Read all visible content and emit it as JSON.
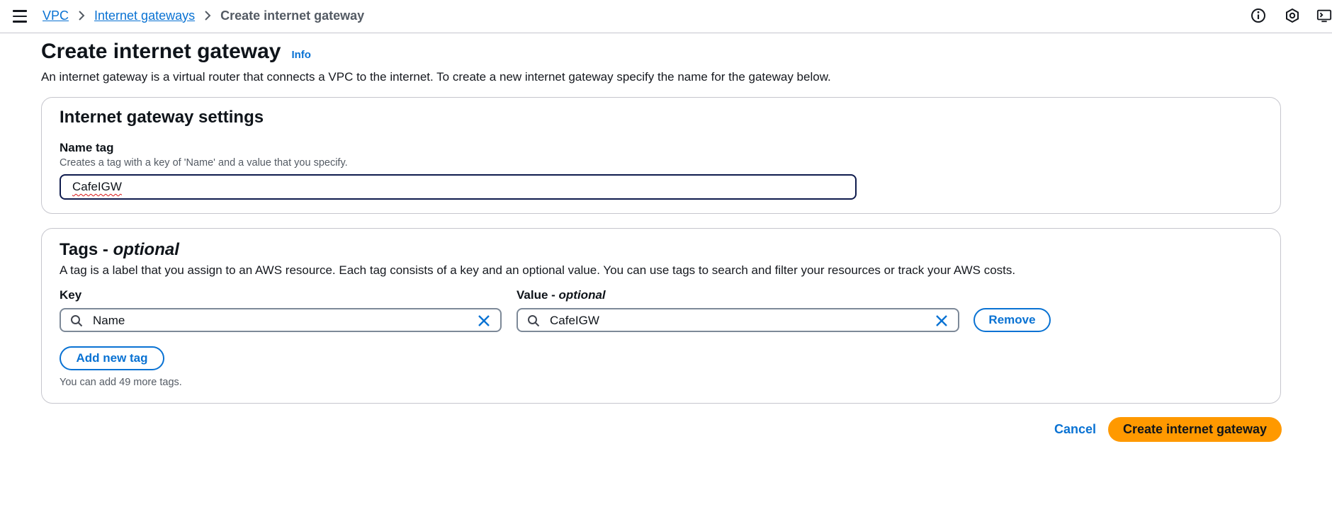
{
  "breadcrumb": {
    "items": [
      {
        "label": "VPC"
      },
      {
        "label": "Internet gateways"
      },
      {
        "label": "Create internet gateway"
      }
    ]
  },
  "header_icons": [
    "info-circle-icon",
    "settings-hex-icon",
    "cloudshell-icon"
  ],
  "page": {
    "title": "Create internet gateway",
    "info_label": "Info",
    "description": "An internet gateway is a virtual router that connects a VPC to the internet. To create a new internet gateway specify the name for the gateway below."
  },
  "settings": {
    "title": "Internet gateway settings",
    "name_tag_label": "Name tag",
    "name_tag_hint": "Creates a tag with a key of 'Name' and a value that you specify.",
    "name_tag_value": "CafeIGW"
  },
  "tags": {
    "title_main": "Tags - ",
    "title_optional": "optional",
    "description": "A tag is a label that you assign to an AWS resource. Each tag consists of a key and an optional value. You can use tags to search and filter your resources or track your AWS costs.",
    "key_label": "Key",
    "value_label_main": "Value - ",
    "value_label_optional": "optional",
    "rows": [
      {
        "key": "Name",
        "value": "CafeIGW",
        "remove_label": "Remove"
      }
    ],
    "add_label": "Add new tag",
    "limit_hint": "You can add 49 more tags."
  },
  "actions": {
    "cancel_label": "Cancel",
    "create_label": "Create internet gateway"
  },
  "colors": {
    "link": "#0972d3",
    "primary": "#ff9900",
    "border": "#c6c6cd"
  }
}
